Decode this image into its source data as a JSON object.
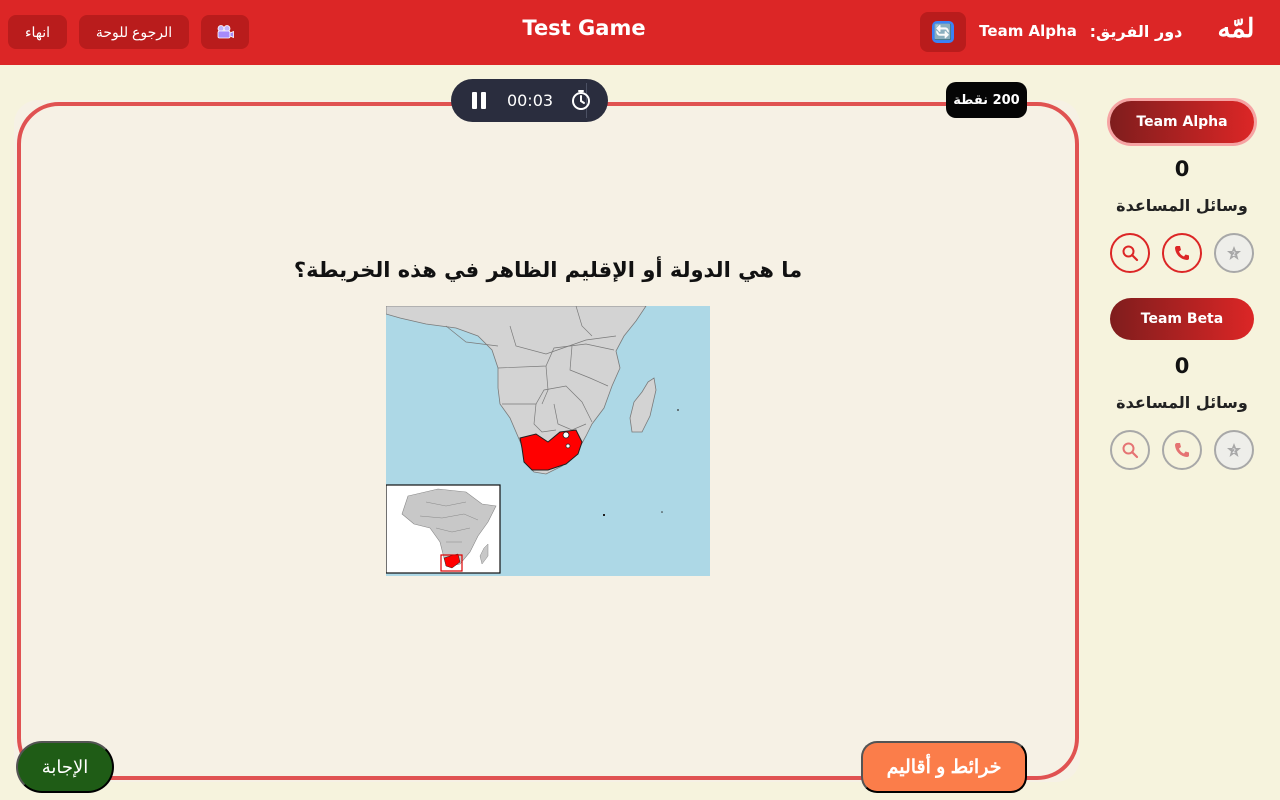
{
  "header": {
    "end_label": "انهاء",
    "back_label": "الرجوع للوحة",
    "camera_icon": "video-camera-icon",
    "title": "Test Game",
    "refresh_icon": "🔄",
    "current_team": "Team Alpha",
    "turn_label": "دور الفريق:",
    "logo": "لمّه"
  },
  "colors": {
    "header": "#dc2626",
    "board_border": "#e05252",
    "answer_button": "#1f5c16",
    "category_button": "#fb7d4a",
    "highlight": "#ff0000"
  },
  "timer": {
    "time": "00:03",
    "pause_icon": "pause-icon",
    "stopwatch_icon": "stopwatch-icon"
  },
  "points": "200 نقطة",
  "question": "ما هي الدولة أو الإقليم الظاهر في هذه الخريطة؟",
  "map": {
    "highlighted_region": "South Africa",
    "icon": "map-image"
  },
  "answer_label": "الإجابة",
  "category_label": "خرائط و أقاليم",
  "teams": [
    {
      "name": "Team Alpha",
      "score": "0",
      "lifelines_label": "وسائل المساعدة",
      "active": true,
      "lifelines": [
        "search-icon",
        "phone-icon",
        "star-icon"
      ]
    },
    {
      "name": "Team Beta",
      "score": "0",
      "lifelines_label": "وسائل المساعدة",
      "active": false,
      "lifelines": [
        "search-icon",
        "phone-icon",
        "star-icon"
      ]
    }
  ]
}
